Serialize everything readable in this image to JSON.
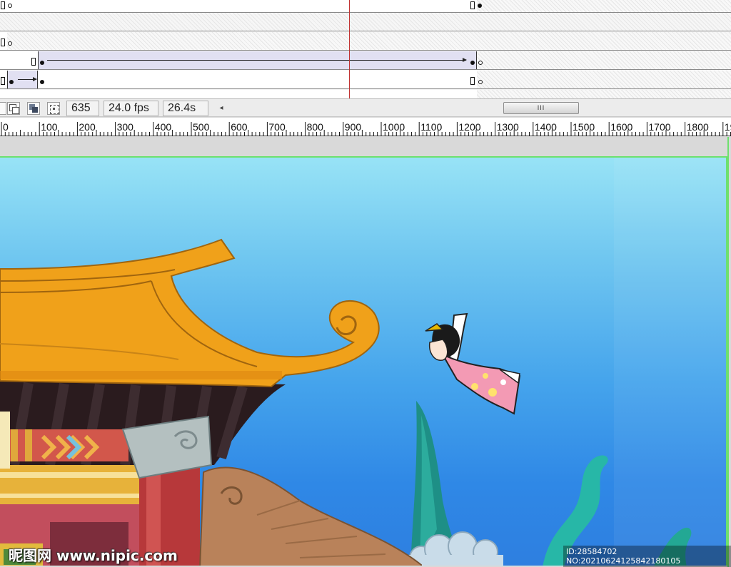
{
  "timeline": {
    "frame_number": "635",
    "frame_rate": "24.0 fps",
    "elapsed_time": "26.4s"
  },
  "statusbar_icons": [
    "onion-skin-icon",
    "onion-skin-outlines-icon",
    "edit-multiple-frames-icon",
    "modify-onion-markers-icon"
  ],
  "scrollbar": {
    "left_arrow": "◂",
    "thumb_grip": "III"
  },
  "ruler": {
    "labels": [
      "0",
      "100",
      "200",
      "300",
      "400",
      "500",
      "600",
      "700",
      "800",
      "900",
      "1000",
      "1100",
      "1200",
      "1300",
      "1400",
      "1500",
      "1600",
      "1700",
      "1800",
      "19"
    ]
  },
  "watermark": {
    "left": "昵图网 www.nipic.com",
    "right": "ID:28584702 NO:20210624125842180105"
  }
}
